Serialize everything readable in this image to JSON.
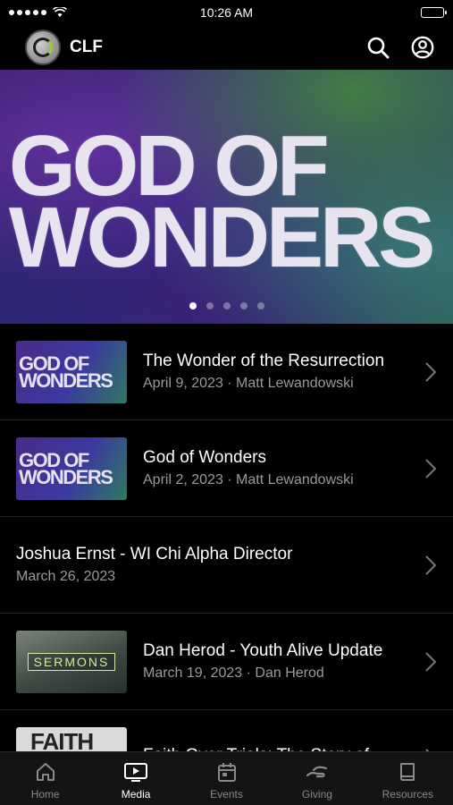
{
  "status": {
    "time": "10:26 AM"
  },
  "header": {
    "title": "CLF"
  },
  "hero": {
    "line1": "GOD OF",
    "line2": "WONDERS",
    "page_count": 5,
    "active_page": 1
  },
  "items": [
    {
      "thumb_text": "GOD OF WONDERS",
      "title": "The Wonder of the Resurrection",
      "subtitle": "April 9, 2023 · Matt Lewandowski"
    },
    {
      "thumb_text": "GOD OF WONDERS",
      "title": "God of Wonders",
      "subtitle": "April 2, 2023 · Matt Lewandowski"
    },
    {
      "title": "Joshua Ernst - WI Chi Alpha Director",
      "subtitle": "March 26, 2023"
    },
    {
      "thumb_text": "SERMONS",
      "title": "Dan Herod - Youth Alive Update",
      "subtitle": "March 19, 2023 · Dan Herod"
    },
    {
      "thumb_text": "FAITH",
      "title": "Faith Over Trials: The Story of"
    }
  ],
  "tabs": [
    {
      "label": "Home",
      "icon": "home-icon"
    },
    {
      "label": "Media",
      "icon": "media-tv-icon",
      "active": true
    },
    {
      "label": "Events",
      "icon": "calendar-icon"
    },
    {
      "label": "Giving",
      "icon": "giving-hand-icon"
    },
    {
      "label": "Resources",
      "icon": "book-icon"
    }
  ]
}
